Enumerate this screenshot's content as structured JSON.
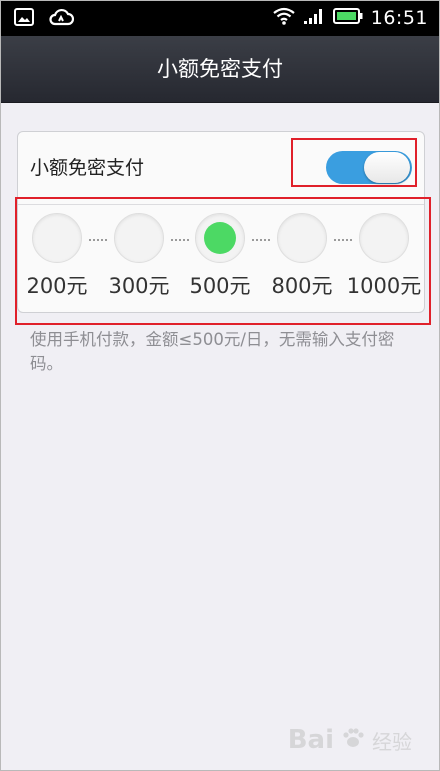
{
  "status_bar": {
    "time": "16:51",
    "icons_left": [
      "image-notification-icon",
      "cloud-icon"
    ],
    "icons_right": [
      "wifi-icon",
      "signal-icon",
      "battery-icon"
    ],
    "battery_color": "#4cd964"
  },
  "title": "小额免密支付",
  "setting": {
    "label": "小额免密支付",
    "enabled": true,
    "toggle_color": "#3a9ee0"
  },
  "amounts": {
    "options": [
      "200元",
      "300元",
      "500元",
      "800元",
      "1000元"
    ],
    "selected": "500元",
    "selected_color": "#4cd964"
  },
  "description": "使用手机付款，金额≤500元/日，无需输入支付密码。",
  "highlight_color": "#e0202a",
  "watermark": {
    "brand": "Bai",
    "text": "经验"
  }
}
